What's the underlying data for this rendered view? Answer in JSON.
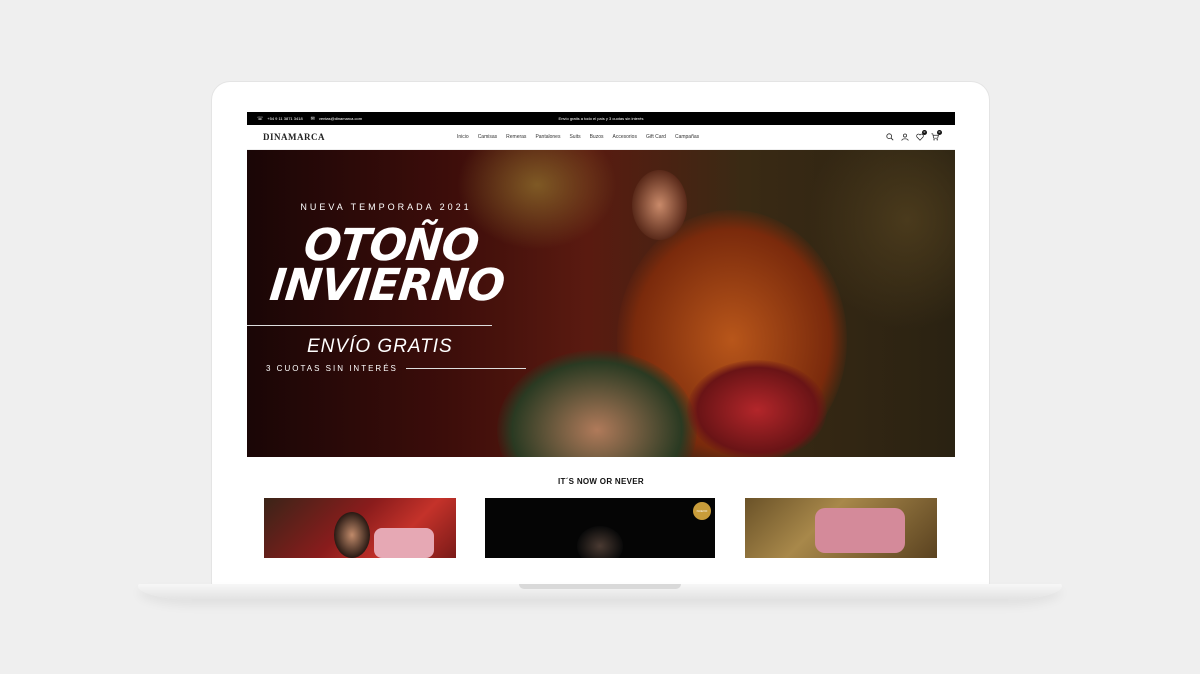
{
  "topbar": {
    "phone": "+54 9 11 3871 3418",
    "email": "ventas@dinamarca.com",
    "promo": "Envío gratis a todo el país y 3 cuotas sin interés"
  },
  "header": {
    "logo": "DINAMARCA",
    "menu": [
      "Inicio",
      "Camisas",
      "Remeras",
      "Pantalones",
      "Suits",
      "Buzos",
      "Accesorios",
      "Gift Card",
      "Campañas"
    ],
    "wishlist_count": "0",
    "cart_count": "0"
  },
  "hero": {
    "season": "NUEVA TEMPORADA 2021",
    "title_line1": "OTOÑO",
    "title_line2": "INVIERNO",
    "shipping": "ENVÍO GRATIS",
    "installments": "3 CUOTAS SIN INTERÉS"
  },
  "section": {
    "title": "IT´S NOW OR NEVER"
  },
  "products": [
    {
      "badge": ""
    },
    {
      "badge": "NUEVO"
    },
    {
      "badge": ""
    }
  ],
  "colors": {
    "page_bg": "#efefef",
    "topbar_bg": "#000000",
    "badge_gold": "#c89c3a"
  }
}
